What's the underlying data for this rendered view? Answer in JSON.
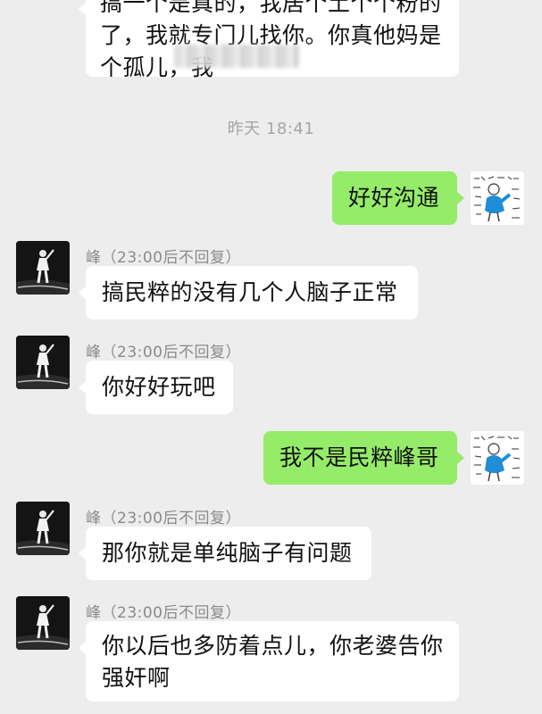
{
  "top_message": {
    "line1": "搞一个是真的，我居个土个个粉的",
    "line2": "了，我就专门儿找你。你真他妈是",
    "line3": "个孤儿，我"
  },
  "timestamp": "昨天 18:41",
  "contact": {
    "sender_label": "峰（23:00后不回复）"
  },
  "messages": [
    {
      "side": "out",
      "text": "好好沟通"
    },
    {
      "side": "in",
      "text": "搞民粹的没有几个人脑子正常"
    },
    {
      "side": "in",
      "text": "你好好玩吧"
    },
    {
      "side": "out",
      "text": "我不是民粹峰哥"
    },
    {
      "side": "in",
      "text": "那你就是单纯脑子有问题"
    },
    {
      "side": "in",
      "text": "你以后也多防着点儿，你老婆告你\n强奸啊"
    }
  ],
  "colors": {
    "background": "#ededed",
    "incoming_bubble": "#ffffff",
    "outgoing_bubble": "#95ec69",
    "meta_text": "#8a8a8a"
  }
}
